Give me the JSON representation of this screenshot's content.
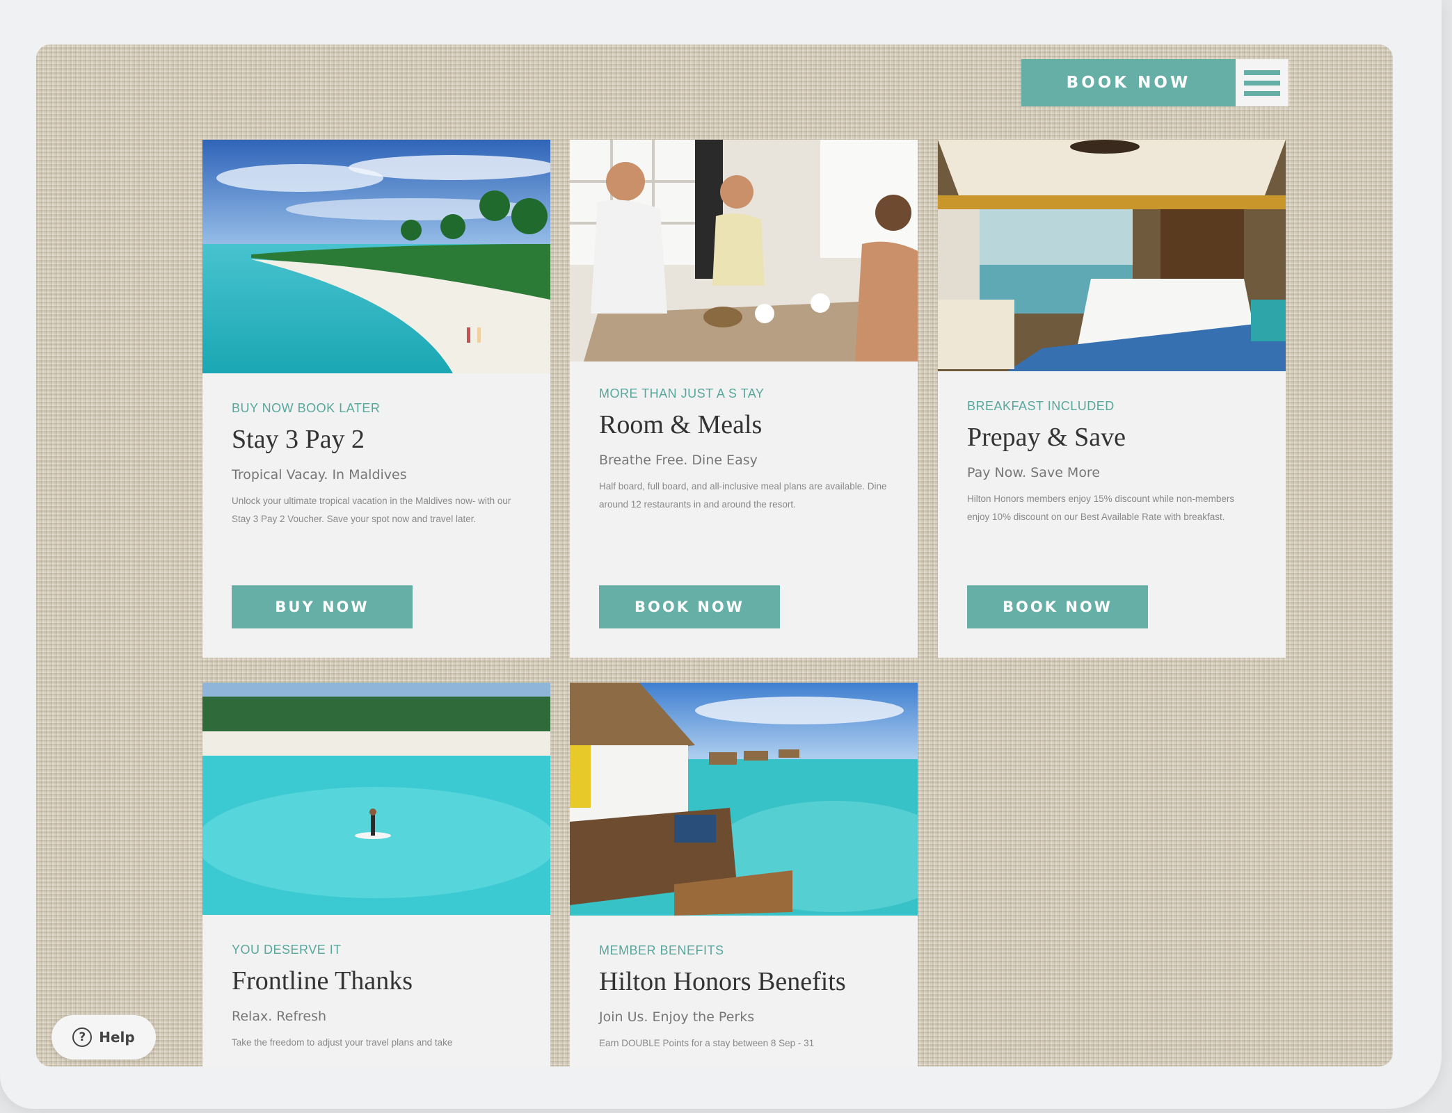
{
  "header": {
    "book_now": "BOOK NOW",
    "menu_icon": "hamburger-menu-icon"
  },
  "cards": [
    {
      "eyebrow": "BUY NOW BOOK LATER",
      "title": "Stay 3 Pay 2",
      "subtitle": "Tropical Vacay. In Maldives",
      "description": "Unlock your ultimate tropical vacation in the Maldives now- with our Stay 3 Pay 2 Voucher. Save your spot now and travel later.",
      "cta": "BUY NOW"
    },
    {
      "eyebrow": "MORE THAN JUST A S TAY",
      "title": "Room & Meals",
      "subtitle": "Breathe Free. Dine Easy",
      "description": "Half board, full board, and all-inclusive meal plans are available. Dine around 12 restaurants in and around the resort.",
      "cta": "BOOK NOW"
    },
    {
      "eyebrow": "BREAKFAST INCLUDED",
      "title": "Prepay & Save",
      "subtitle": "Pay Now. Save More",
      "description": "Hilton Honors members enjoy 15% discount while non-members enjoy 10% discount on our Best Available Rate with breakfast.",
      "cta": "BOOK NOW"
    },
    {
      "eyebrow": "YOU DESERVE IT",
      "title": "Frontline Thanks",
      "subtitle": "Relax. Refresh",
      "description": "Take the freedom to adjust your travel plans and take"
    },
    {
      "eyebrow": "MEMBER BENEFITS",
      "title": "Hilton Honors Benefits",
      "subtitle": "Join Us. Enjoy the Perks",
      "description": "Earn DOUBLE Points for a stay between 8 Sep - 31"
    }
  ],
  "help": {
    "label": "Help",
    "icon": "question-circle-icon"
  },
  "colors": {
    "accent": "#66afa6",
    "card_bg": "#f2f2f2",
    "linen": "#ddd5c4"
  }
}
